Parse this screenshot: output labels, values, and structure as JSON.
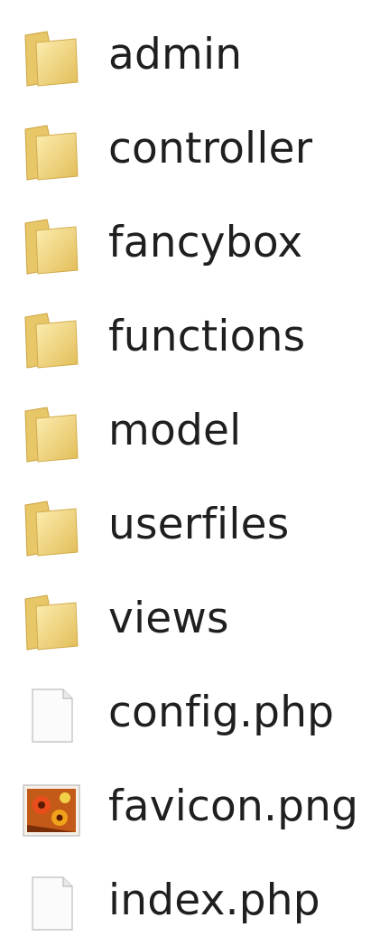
{
  "files": [
    {
      "name": "admin",
      "icon": "folder-icon"
    },
    {
      "name": "controller",
      "icon": "folder-icon"
    },
    {
      "name": "fancybox",
      "icon": "folder-icon"
    },
    {
      "name": "functions",
      "icon": "folder-icon"
    },
    {
      "name": "model",
      "icon": "folder-icon"
    },
    {
      "name": "userfiles",
      "icon": "folder-icon"
    },
    {
      "name": "views",
      "icon": "folder-icon"
    },
    {
      "name": "config.php",
      "icon": "document-icon"
    },
    {
      "name": "favicon.png",
      "icon": "image-icon"
    },
    {
      "name": "index.php",
      "icon": "document-icon"
    }
  ],
  "colors": {
    "folder_light": "#f8e08a",
    "folder_dark": "#d9b24a",
    "text": "#1f1f1f"
  }
}
